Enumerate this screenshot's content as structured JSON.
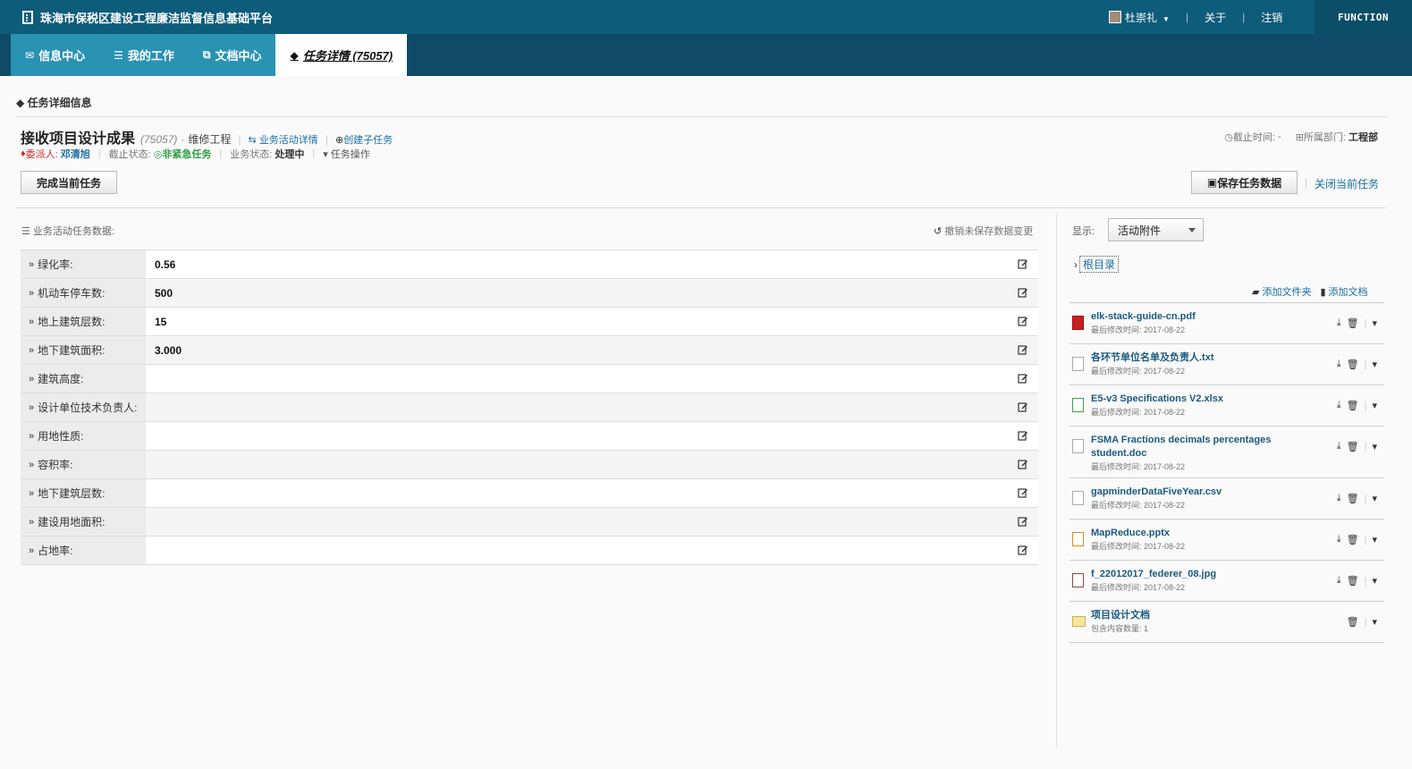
{
  "header": {
    "app_title": "珠海市保税区建设工程廉洁监督信息基础平台",
    "user_name": "杜崇礼",
    "about": "关于",
    "logout": "注销",
    "function_label": "FUNCTION"
  },
  "tabs": [
    {
      "label": "信息中心",
      "icon": "envelope-icon"
    },
    {
      "label": "我的工作",
      "icon": "list-icon"
    },
    {
      "label": "文档中心",
      "icon": "copy-icon"
    },
    {
      "label": "任务详情 (75057)",
      "icon": "tag-icon",
      "active": true
    }
  ],
  "section": {
    "title": "任务详细信息"
  },
  "task": {
    "title": "接收项目设计成果",
    "id": "(75057)",
    "dot": "·",
    "category": "维修工程",
    "activity_link": "业务活动详情",
    "create_subtask": "创建子任务",
    "assigner_label": "委派人:",
    "assigner": "邓清旭",
    "deadline_status_label": "截止状态:",
    "deadline_status": "非紧急任务",
    "biz_status_label": "业务状态:",
    "biz_status": "处理中",
    "task_ops": "任务操作",
    "deadline_label": "截止时间:",
    "deadline_value": "-",
    "dept_label": "所属部门:",
    "dept_value": "工程部"
  },
  "buttons": {
    "complete": "完成当前任务",
    "save": "保存任务数据",
    "close": "关闭当前任务"
  },
  "data_panel": {
    "title": "业务活动任务数据:",
    "undo": "撤销未保存数据变更",
    "rows": [
      {
        "label": "绿化率:",
        "value": "0.56"
      },
      {
        "label": "机动车停车数:",
        "value": "500"
      },
      {
        "label": "地上建筑层数:",
        "value": "15"
      },
      {
        "label": "地下建筑面积:",
        "value": "3.000"
      },
      {
        "label": "建筑高度:",
        "value": ""
      },
      {
        "label": "设计单位技术负责人:",
        "value": ""
      },
      {
        "label": "用地性质:",
        "value": ""
      },
      {
        "label": "容积率:",
        "value": ""
      },
      {
        "label": "地下建筑层数:",
        "value": ""
      },
      {
        "label": "建设用地面积:",
        "value": ""
      },
      {
        "label": "占地率:",
        "value": ""
      }
    ]
  },
  "files_panel": {
    "display_label": "显示:",
    "display_selected": "活动附件",
    "root": "根目录",
    "add_folder": "添加文件夹",
    "add_doc": "添加文档",
    "files": [
      {
        "name": "elk-stack-guide-cn.pdf",
        "meta": "最后修改时间: 2017-08-22",
        "type": "pdf"
      },
      {
        "name": "各环节单位名单及负责人.txt",
        "meta": "最后修改时间: 2017-08-22",
        "type": "txt"
      },
      {
        "name": "E5-v3 Specifications V2.xlsx",
        "meta": "最后修改时间: 2017-08-22",
        "type": "xlsx"
      },
      {
        "name": "FSMA Fractions decimals percentages student.doc",
        "meta": "最后修改时间: 2017-08-22",
        "type": "doc"
      },
      {
        "name": "gapminderDataFiveYear.csv",
        "meta": "最后修改时间: 2017-08-22",
        "type": "csv"
      },
      {
        "name": "MapReduce.pptx",
        "meta": "最后修改时间: 2017-08-22",
        "type": "pptx"
      },
      {
        "name": "f_22012017_federer_08.jpg",
        "meta": "最后修改时间: 2017-08-22",
        "type": "jpg"
      },
      {
        "name": "项目设计文档",
        "meta": "包含内容数量: 1",
        "type": "folder"
      }
    ]
  }
}
